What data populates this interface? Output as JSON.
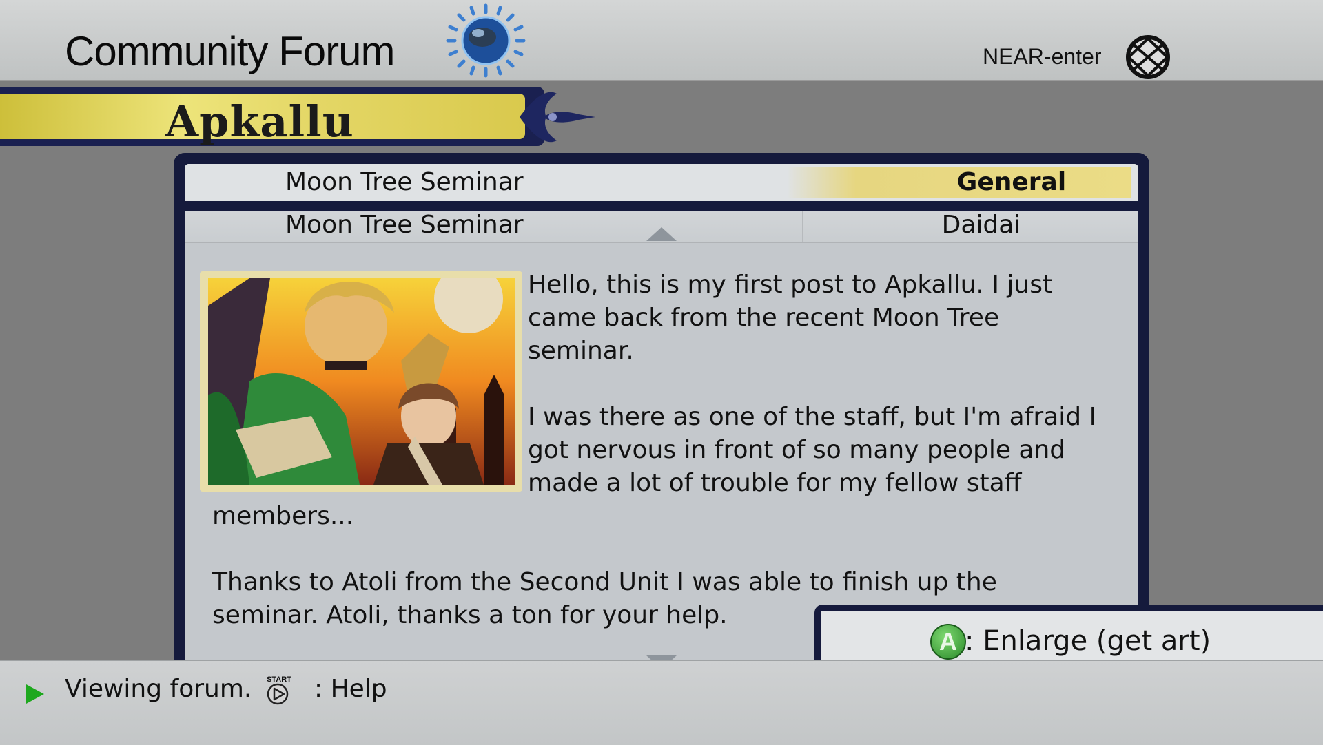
{
  "header": {
    "title": "Community Forum",
    "network_label": "NEAR-enter",
    "globe_icon": "globe-icon",
    "network_icon": "network-globe-icon"
  },
  "forum": {
    "name": "Apkallu"
  },
  "threads": [
    {
      "title": "Moon Tree Seminar",
      "category": "General",
      "selected": true
    },
    {
      "title": "Moon Tree Seminar",
      "category": "Daidai",
      "selected": false
    }
  ],
  "post": {
    "image_label": "post artwork",
    "paragraphs": [
      "Hello, this is my first post to Apkallu. I just came back from the recent Moon Tree seminar.",
      "I was there as one of the staff, but I'm afraid I got nervous in front of so many people and made a lot of trouble for my fellow staff members...",
      "Thanks to Atoli from the Second Unit I was able to finish up the seminar. Atoli, thanks a ton for your help."
    ]
  },
  "actions": {
    "enlarge_button": "A",
    "enlarge_label": ": Enlarge (get art)"
  },
  "footer": {
    "status": "Viewing forum.",
    "start_icon_text": "START",
    "help_label": ": Help"
  },
  "colors": {
    "banner_gold": "#e4d766",
    "panel_navy": "#151a3c",
    "selected_highlight": "#ebdc86",
    "accent_green": "#1ea81e"
  }
}
